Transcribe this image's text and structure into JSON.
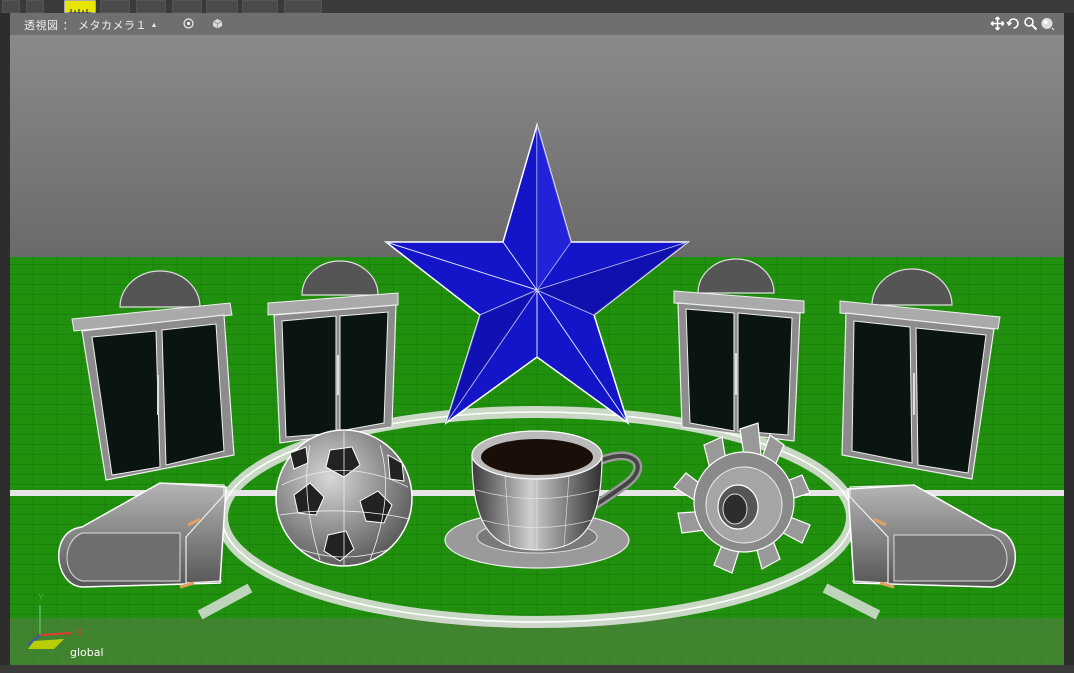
{
  "viewport": {
    "title": "透視図 ： メタカメラ１",
    "camera_arrow": "▴",
    "axis_label": "global",
    "axis_x": "X",
    "axis_y": "Y"
  },
  "toolbar": {
    "active_tool": "ruler-tool"
  },
  "nav_tools": [
    "move-icon",
    "rotate-icon",
    "zoom-icon",
    "display-mode-icon"
  ],
  "scene": {
    "objects": [
      "star",
      "window",
      "window",
      "window",
      "window",
      "soccer-ball",
      "coffee-cup",
      "gear",
      "book",
      "book"
    ],
    "colors": {
      "sky": "#7a7a7a",
      "ground": "#1f8a14",
      "star": "#1414c8",
      "window_glass": "#0a1512",
      "lines": "#e8e8e8"
    }
  }
}
